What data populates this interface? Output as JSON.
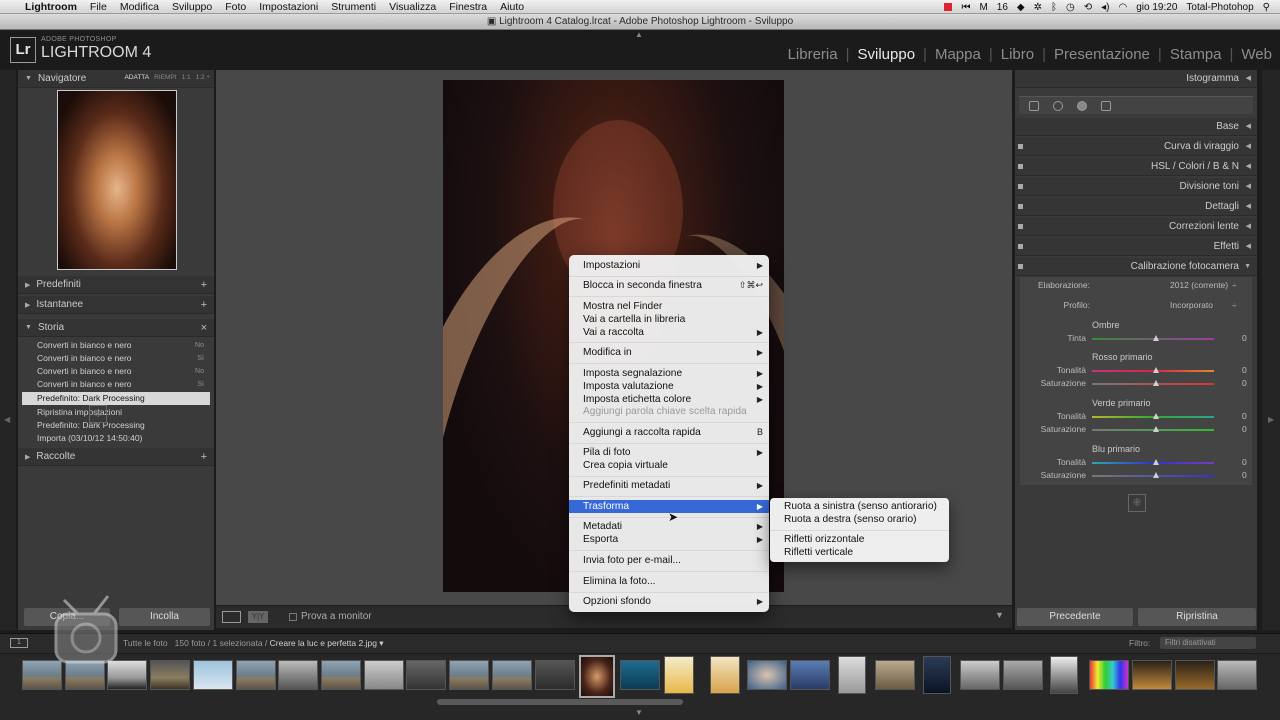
{
  "menubar": {
    "app_name": "Lightroom",
    "items": [
      "File",
      "Modifica",
      "Sviluppo",
      "Foto",
      "Impostazioni",
      "Strumenti",
      "Visualizza",
      "Finestra",
      "Aiuto"
    ],
    "right_num": "16",
    "clock": "gio 19:20",
    "user": "Total-Photohop"
  },
  "window": {
    "title": "Lightroom 4 Catalog.lrcat - Adobe Photoshop Lightroom - Sviluppo"
  },
  "brand": {
    "badge": "Lr",
    "small": "ADOBE PHOTOSHOP",
    "large": "LIGHTROOM 4"
  },
  "modules": [
    {
      "label": "Libreria"
    },
    {
      "label": "Sviluppo",
      "active": true
    },
    {
      "label": "Mappa"
    },
    {
      "label": "Libro"
    },
    {
      "label": "Presentazione"
    },
    {
      "label": "Stampa"
    },
    {
      "label": "Web"
    }
  ],
  "left": {
    "navigator": {
      "title": "Navigatore",
      "opts": [
        "ADATTA",
        "RIEMPI",
        "1:1",
        "1:2 ÷"
      ]
    },
    "predefiniti": "Predefiniti",
    "istantanee": "Istantanee",
    "storia": "Storia",
    "history": [
      {
        "label": "Converti in bianco e nero",
        "state": "No"
      },
      {
        "label": "Converti in bianco e nero",
        "state": "Sì"
      },
      {
        "label": "Converti in bianco e nero",
        "state": "No"
      },
      {
        "label": "Converti in bianco e nero",
        "state": "Sì"
      },
      {
        "label": "Predefinito: Dark Processing",
        "state": ""
      },
      {
        "label": "Ripristina impostazioni",
        "state": ""
      },
      {
        "label": "Predefinito: Dark Processing",
        "state": ""
      },
      {
        "label": "Importa (03/10/12 14:50:40)",
        "state": ""
      }
    ],
    "raccolte": "Raccolte",
    "copy_btn": "Copia...",
    "paste_btn": "Incolla"
  },
  "toolbar": {
    "proof": "Prova a monitor"
  },
  "right": {
    "histogram": "Istogramma",
    "panels": [
      "Base",
      "Curva di viraggio",
      "HSL  /  Colori  /  B & N",
      "Divisione toni",
      "Dettagli",
      "Correzioni lente",
      "Effetti",
      "Calibrazione fotocamera"
    ],
    "process_label": "Elaborazione:",
    "process_value": "2012 (corrente)",
    "profile_label": "Profilo:",
    "profile_value": "Incorporato",
    "groups": [
      {
        "title": "Ombre",
        "sliders": [
          {
            "label": "Tinta",
            "value": "0"
          }
        ]
      },
      {
        "title": "Rosso primario",
        "sliders": [
          {
            "label": "Tonalità",
            "value": "0"
          },
          {
            "label": "Saturazione",
            "value": "0"
          }
        ]
      },
      {
        "title": "Verde primario",
        "sliders": [
          {
            "label": "Tonalità",
            "value": "0"
          },
          {
            "label": "Saturazione",
            "value": "0"
          }
        ]
      },
      {
        "title": "Blu primario",
        "sliders": [
          {
            "label": "Tonalità",
            "value": "0"
          },
          {
            "label": "Saturazione",
            "value": "0"
          }
        ]
      }
    ],
    "prev_btn": "Precedente",
    "reset_btn": "Ripristina"
  },
  "filmstrip": {
    "source_prefix": "Tutte le foto",
    "source_count": "150 foto / 1 selezionata /",
    "source_file": "Creare la luc e perfetta 2.jpg ▾",
    "filter_label": "Filtro:",
    "filter_value": "Filtri disattivati"
  },
  "context_menu": [
    {
      "label": "Impostazioni",
      "sub": true
    },
    {
      "divider": true
    },
    {
      "label": "Blocca in seconda finestra",
      "shortcut": "⇧⌘↩"
    },
    {
      "divider": true
    },
    {
      "label": "Mostra nel Finder"
    },
    {
      "label": "Vai a cartella in libreria"
    },
    {
      "label": "Vai a raccolta",
      "sub": true
    },
    {
      "divider": true
    },
    {
      "label": "Modifica in",
      "sub": true
    },
    {
      "divider": true
    },
    {
      "label": "Imposta segnalazione",
      "sub": true
    },
    {
      "label": "Imposta valutazione",
      "sub": true
    },
    {
      "label": "Imposta etichetta colore",
      "sub": true
    },
    {
      "label": "Aggiungi parola chiave scelta rapida",
      "disabled": true
    },
    {
      "divider": true
    },
    {
      "label": "Aggiungi a raccolta rapida",
      "shortcut": "B"
    },
    {
      "divider": true
    },
    {
      "label": "Pila di foto",
      "sub": true
    },
    {
      "label": "Crea copia virtuale"
    },
    {
      "divider": true
    },
    {
      "label": "Predefiniti metadati",
      "sub": true
    },
    {
      "divider": true
    },
    {
      "label": "Trasforma",
      "sub": true,
      "highlight": true
    },
    {
      "divider": true
    },
    {
      "label": "Metadati",
      "sub": true
    },
    {
      "label": "Esporta",
      "sub": true
    },
    {
      "divider": true
    },
    {
      "label": "Invia foto per e-mail..."
    },
    {
      "divider": true
    },
    {
      "label": "Elimina la foto..."
    },
    {
      "divider": true
    },
    {
      "label": "Opzioni sfondo",
      "sub": true
    }
  ],
  "submenu": [
    {
      "label": "Ruota a sinistra (senso antiorario)"
    },
    {
      "label": "Ruota a destra (senso orario)"
    },
    {
      "divider": true
    },
    {
      "label": "Rifletti orizzontale"
    },
    {
      "label": "Rifletti verticale"
    }
  ]
}
